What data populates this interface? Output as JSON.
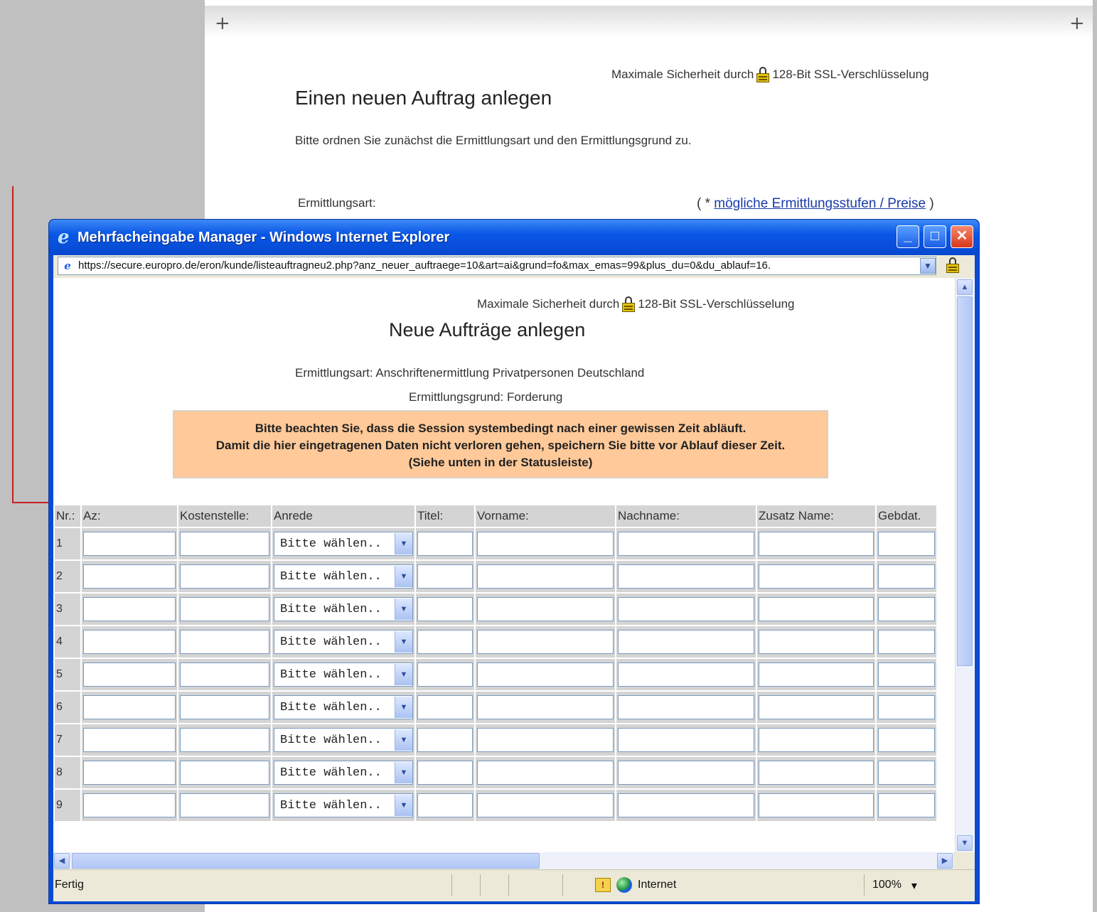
{
  "background_page": {
    "security_prefix": "Maximale Sicherheit durch",
    "security_suffix": "128-Bit SSL-Verschlüsselung",
    "title": "Einen neuen Auftrag anlegen",
    "intro": "Bitte ordnen Sie zunächst die Ermittlungsart und den Ermittlungsgrund zu.",
    "ermittlungsart_label": "Ermittlungsart:",
    "link_prefix": "( * ",
    "link_text": "mögliche Ermittlungsstufen / Preise",
    "link_suffix": " )"
  },
  "window": {
    "title": "Mehrfacheingabe Manager - Windows Internet Explorer",
    "url": "https://secure.europro.de/eron/kunde/listeauftragneu2.php?anz_neuer_auftraege=10&art=ai&grund=fo&max_emas=99&plus_du=0&du_ablauf=16.",
    "minimize_label": "_",
    "maximize_label": "□",
    "close_label": "✕"
  },
  "popup": {
    "security_prefix": "Maximale Sicherheit durch",
    "security_suffix": "128-Bit SSL-Verschlüsselung",
    "title": "Neue Aufträge anlegen",
    "ermittlungsart": "Ermittlungsart: Anschriftenermittlung Privatpersonen Deutschland",
    "ermittlungsgrund": "Ermittlungsgrund: Forderung",
    "notice_line1": "Bitte beachten Sie, dass die Session systembedingt nach einer gewissen Zeit abläuft.",
    "notice_line2": "Damit die hier eingetragenen Daten nicht verloren gehen, speichern Sie bitte vor Ablauf dieser Zeit.",
    "notice_line3": "(Siehe unten in der Statusleiste)"
  },
  "table": {
    "columns": [
      "Nr.:",
      "Az:",
      "Kostenstelle:",
      "Anrede",
      "Titel:",
      "Vorname:",
      "Nachname:",
      "Zusatz Name:",
      "Gebdat."
    ],
    "rows": [
      "1",
      "2",
      "3",
      "4",
      "5",
      "6",
      "7",
      "8",
      "9"
    ],
    "anrede_value": "Bitte wählen.."
  },
  "statusbar": {
    "status": "Fertig",
    "zone": "Internet",
    "zoom": "100%",
    "zoom_dropdown": "▾"
  },
  "colors": {
    "titlebar": "#0a57e6",
    "notice_bg": "#ffc999",
    "link": "#1a3aa8",
    "annotation_arrow": "#c62020"
  }
}
